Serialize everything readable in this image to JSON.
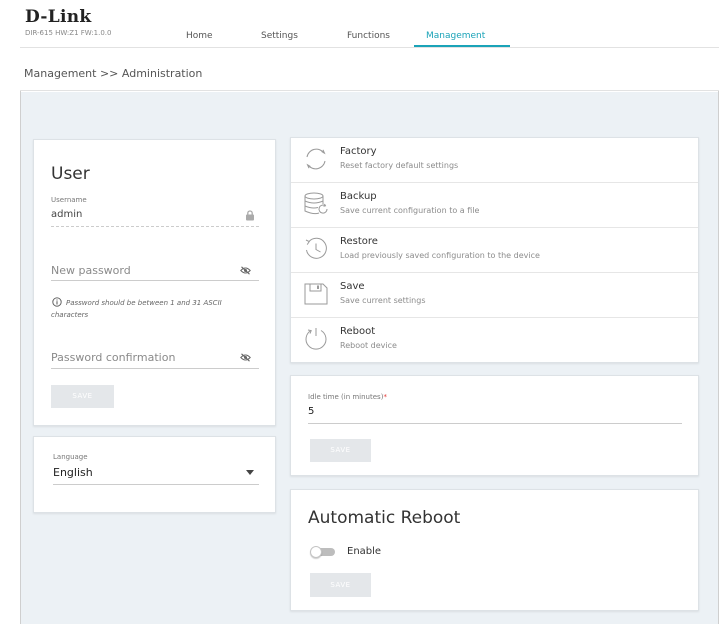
{
  "header": {
    "brand": "D-Link",
    "firmware": "DIR-615 HW:Z1 FW:1.0.0",
    "nav": [
      {
        "label": "Home",
        "active": false
      },
      {
        "label": "Settings",
        "active": false
      },
      {
        "label": "Functions",
        "active": false
      },
      {
        "label": "Management",
        "active": true
      }
    ],
    "accent_color": "#1aa3b8"
  },
  "breadcrumb": "Management >> Administration",
  "user_card": {
    "title": "User",
    "username_label": "Username",
    "username_value": "admin",
    "new_password_placeholder": "New password",
    "password_hint": "Password should be between 1 and 31 ASCII characters",
    "confirm_placeholder": "Password confirmation",
    "save_label": "SAVE"
  },
  "language_card": {
    "label": "Language",
    "value": "English"
  },
  "actions": [
    {
      "icon": "factory-reset-icon",
      "title": "Factory",
      "subtitle": "Reset factory default settings"
    },
    {
      "icon": "backup-icon",
      "title": "Backup",
      "subtitle": "Save current configuration to a file"
    },
    {
      "icon": "restore-icon",
      "title": "Restore",
      "subtitle": "Load previously saved configuration to the device"
    },
    {
      "icon": "save-icon",
      "title": "Save",
      "subtitle": "Save current settings"
    },
    {
      "icon": "reboot-icon",
      "title": "Reboot",
      "subtitle": "Reboot device"
    }
  ],
  "idle_card": {
    "label": "Idle time (in minutes)",
    "required_mark": "*",
    "value": "5",
    "save_label": "SAVE"
  },
  "auto_reboot_card": {
    "title": "Automatic Reboot",
    "toggle_label": "Enable",
    "enabled": false,
    "save_label": "SAVE"
  }
}
